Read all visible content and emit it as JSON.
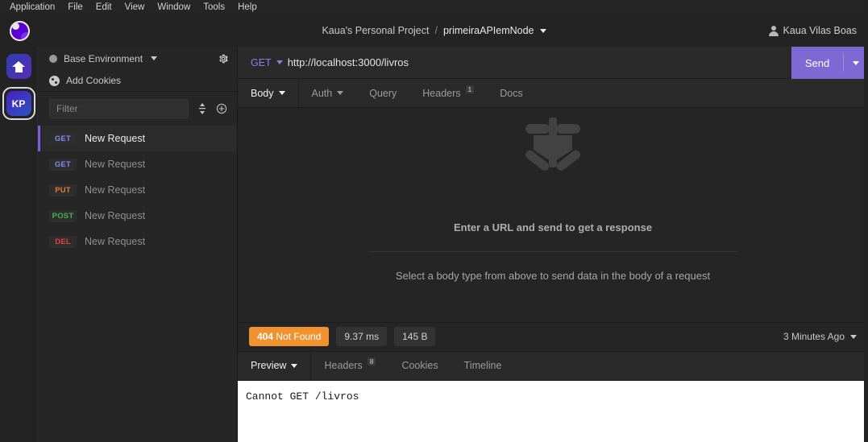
{
  "menubar": {
    "items": [
      "Application",
      "File",
      "Edit",
      "View",
      "Window",
      "Tools",
      "Help"
    ]
  },
  "titlebar": {
    "logo_icon": "insomnia-logo-icon",
    "project_name": "Kaua's Personal Project",
    "separator": "/",
    "workspace_name": "primeiraAPIemNode",
    "workspace_caret_icon": "chevron-down-icon",
    "user_icon": "user-icon",
    "user_name": "Kaua Vilas Boas"
  },
  "rail": {
    "home_label": "",
    "home_icon": "home-icon",
    "avatar_initials": "KP"
  },
  "sidebar": {
    "environment": {
      "dot_icon": "environment-dot-icon",
      "label": "Base Environment",
      "caret_icon": "chevron-down-icon",
      "settings_icon": "gear-icon"
    },
    "cookies": {
      "icon": "cookie-icon",
      "label": "Add Cookies"
    },
    "filter": {
      "value": "",
      "placeholder": "Filter",
      "sort_icon": "sort-icon",
      "add_icon": "plus-circle-icon"
    },
    "requests": [
      {
        "method": "GET",
        "method_class": "m-get",
        "name": "New Request",
        "active": true
      },
      {
        "method": "GET",
        "method_class": "m-get",
        "name": "New Request",
        "active": false
      },
      {
        "method": "PUT",
        "method_class": "m-put",
        "name": "New Request",
        "active": false
      },
      {
        "method": "POST",
        "method_class": "m-post",
        "name": "New Request",
        "active": false
      },
      {
        "method": "DEL",
        "method_class": "m-del",
        "name": "New Request",
        "active": false
      }
    ]
  },
  "request": {
    "method": "GET",
    "method_caret_icon": "chevron-down-icon",
    "url": "http://localhost:3000/livros",
    "url_placeholder": "Enter a URL and send to get a response",
    "send_label": "Send",
    "send_caret_icon": "chevron-down-icon",
    "tabs": [
      {
        "label": "Body",
        "active": true,
        "caret": true,
        "badge": ""
      },
      {
        "label": "Auth",
        "active": false,
        "caret": true,
        "badge": ""
      },
      {
        "label": "Query",
        "active": false,
        "caret": false,
        "badge": ""
      },
      {
        "label": "Headers",
        "active": false,
        "caret": false,
        "badge": "1"
      },
      {
        "label": "Docs",
        "active": false,
        "caret": false,
        "badge": ""
      }
    ],
    "empty_state": {
      "watermark_icon": "insomnia-bug-watermark-icon",
      "title": "Enter a URL and send to get a response",
      "subtitle": "Select a body type from above to send data in the body of a request"
    }
  },
  "response": {
    "status_code": "404",
    "status_text": "Not Found",
    "status_color": "#f0922f",
    "time": "9.37 ms",
    "size": "145 B",
    "timestamp": "3 Minutes Ago",
    "timestamp_caret_icon": "chevron-down-icon",
    "tabs": [
      {
        "label": "Preview",
        "active": true,
        "caret": true,
        "badge": ""
      },
      {
        "label": "Headers",
        "active": false,
        "caret": false,
        "badge": "8"
      },
      {
        "label": "Cookies",
        "active": false,
        "caret": false,
        "badge": ""
      },
      {
        "label": "Timeline",
        "active": false,
        "caret": false,
        "badge": ""
      }
    ],
    "body": "Cannot GET /livros"
  }
}
